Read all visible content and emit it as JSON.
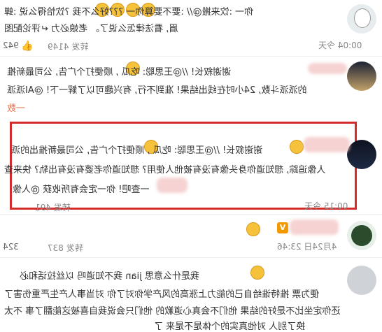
{
  "comments": [
    {
      "line1": "你一 :饮来搬@// :要不要算你一 ???好么不我 ?饮恰得么说 :蝉",
      "line2": "眉, 看法律怎么说了。 老娘必力 ↵评论配图",
      "meta": {
        "time": "00:04 今天",
        "reposts": "转发 4149",
        "likes": "942"
      }
    },
    {
      "line1": "谢谢叙长! //@王思聪: 吃瓜 , 顺便打个广告, 公司最新推",
      "line2": "的派派斗数, 24小时在线出结果! 准到不行, 有兴趣可以了解一下! @AI派派",
      "line3": "一数",
      "meta": {
        "time": "",
        "reposts": "",
        "likes": ""
      }
    },
    {
      "line1": "谢谢叙长! //@王思聪: 吃瓜 , 顺便打个广告, 公司最新推出的派",
      "line2": "人像追踪, 想知道你身头像有没有被他人使用? 想知道你老婆有没有出轨? 快来查",
      "line3": "一查吧! 你一定会有所收获 @人像",
      "meta": {
        "time": "00:15 今天",
        "reposts": "转发 491",
        "likes": ""
      }
    },
    {
      "meta": {
        "time": "4月24日 23:46",
        "reposts": "转发 837",
        "likes": "324"
      }
    },
    {
      "line1": "我是什么意思 jian 我不知道吗 以丝拉话和必",
      "line2": "便为票 推特谁给自己的能力上涨高的风产学你对了你 对当事人产生严重伤害了",
      "line3": "还你定坐比不是好的结果 他们不会真心道歉的 他们只会说我自喜被这能翻了事 不太",
      "line4": "换了别人 对他真实的个体是不是来 了"
    }
  ],
  "redbox_label": "highlight"
}
